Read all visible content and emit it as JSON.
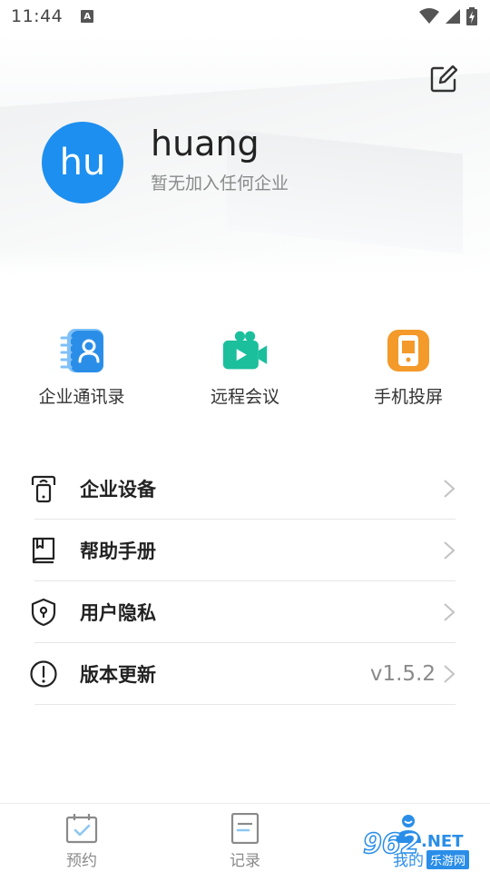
{
  "status_bar": {
    "time": "11:44",
    "notification_letter": "A"
  },
  "profile": {
    "avatar_text": "hu",
    "username": "huang",
    "org_status": "暂无加入任何企业",
    "avatar_color": "#1d8ff0"
  },
  "quick_actions": [
    {
      "label": "企业通讯录",
      "icon": "contacts-book-icon",
      "color": "#2a8ee8"
    },
    {
      "label": "远程会议",
      "icon": "video-camera-icon",
      "color": "#1bbf9c"
    },
    {
      "label": "手机投屏",
      "icon": "phone-cast-icon",
      "color": "#f39a2a"
    }
  ],
  "menu": [
    {
      "label": "企业设备",
      "icon": "device-icon",
      "value": ""
    },
    {
      "label": "帮助手册",
      "icon": "book-icon",
      "value": ""
    },
    {
      "label": "用户隐私",
      "icon": "shield-icon",
      "value": ""
    },
    {
      "label": "版本更新",
      "icon": "info-icon",
      "value": "v1.5.2"
    }
  ],
  "bottom_nav": [
    {
      "label": "预约",
      "icon": "calendar-check-icon"
    },
    {
      "label": "记录",
      "icon": "document-icon"
    },
    {
      "label": "我的",
      "icon": "user-icon"
    }
  ],
  "watermark": {
    "number": "962",
    "domain": ".NET",
    "site": "乐游网"
  }
}
